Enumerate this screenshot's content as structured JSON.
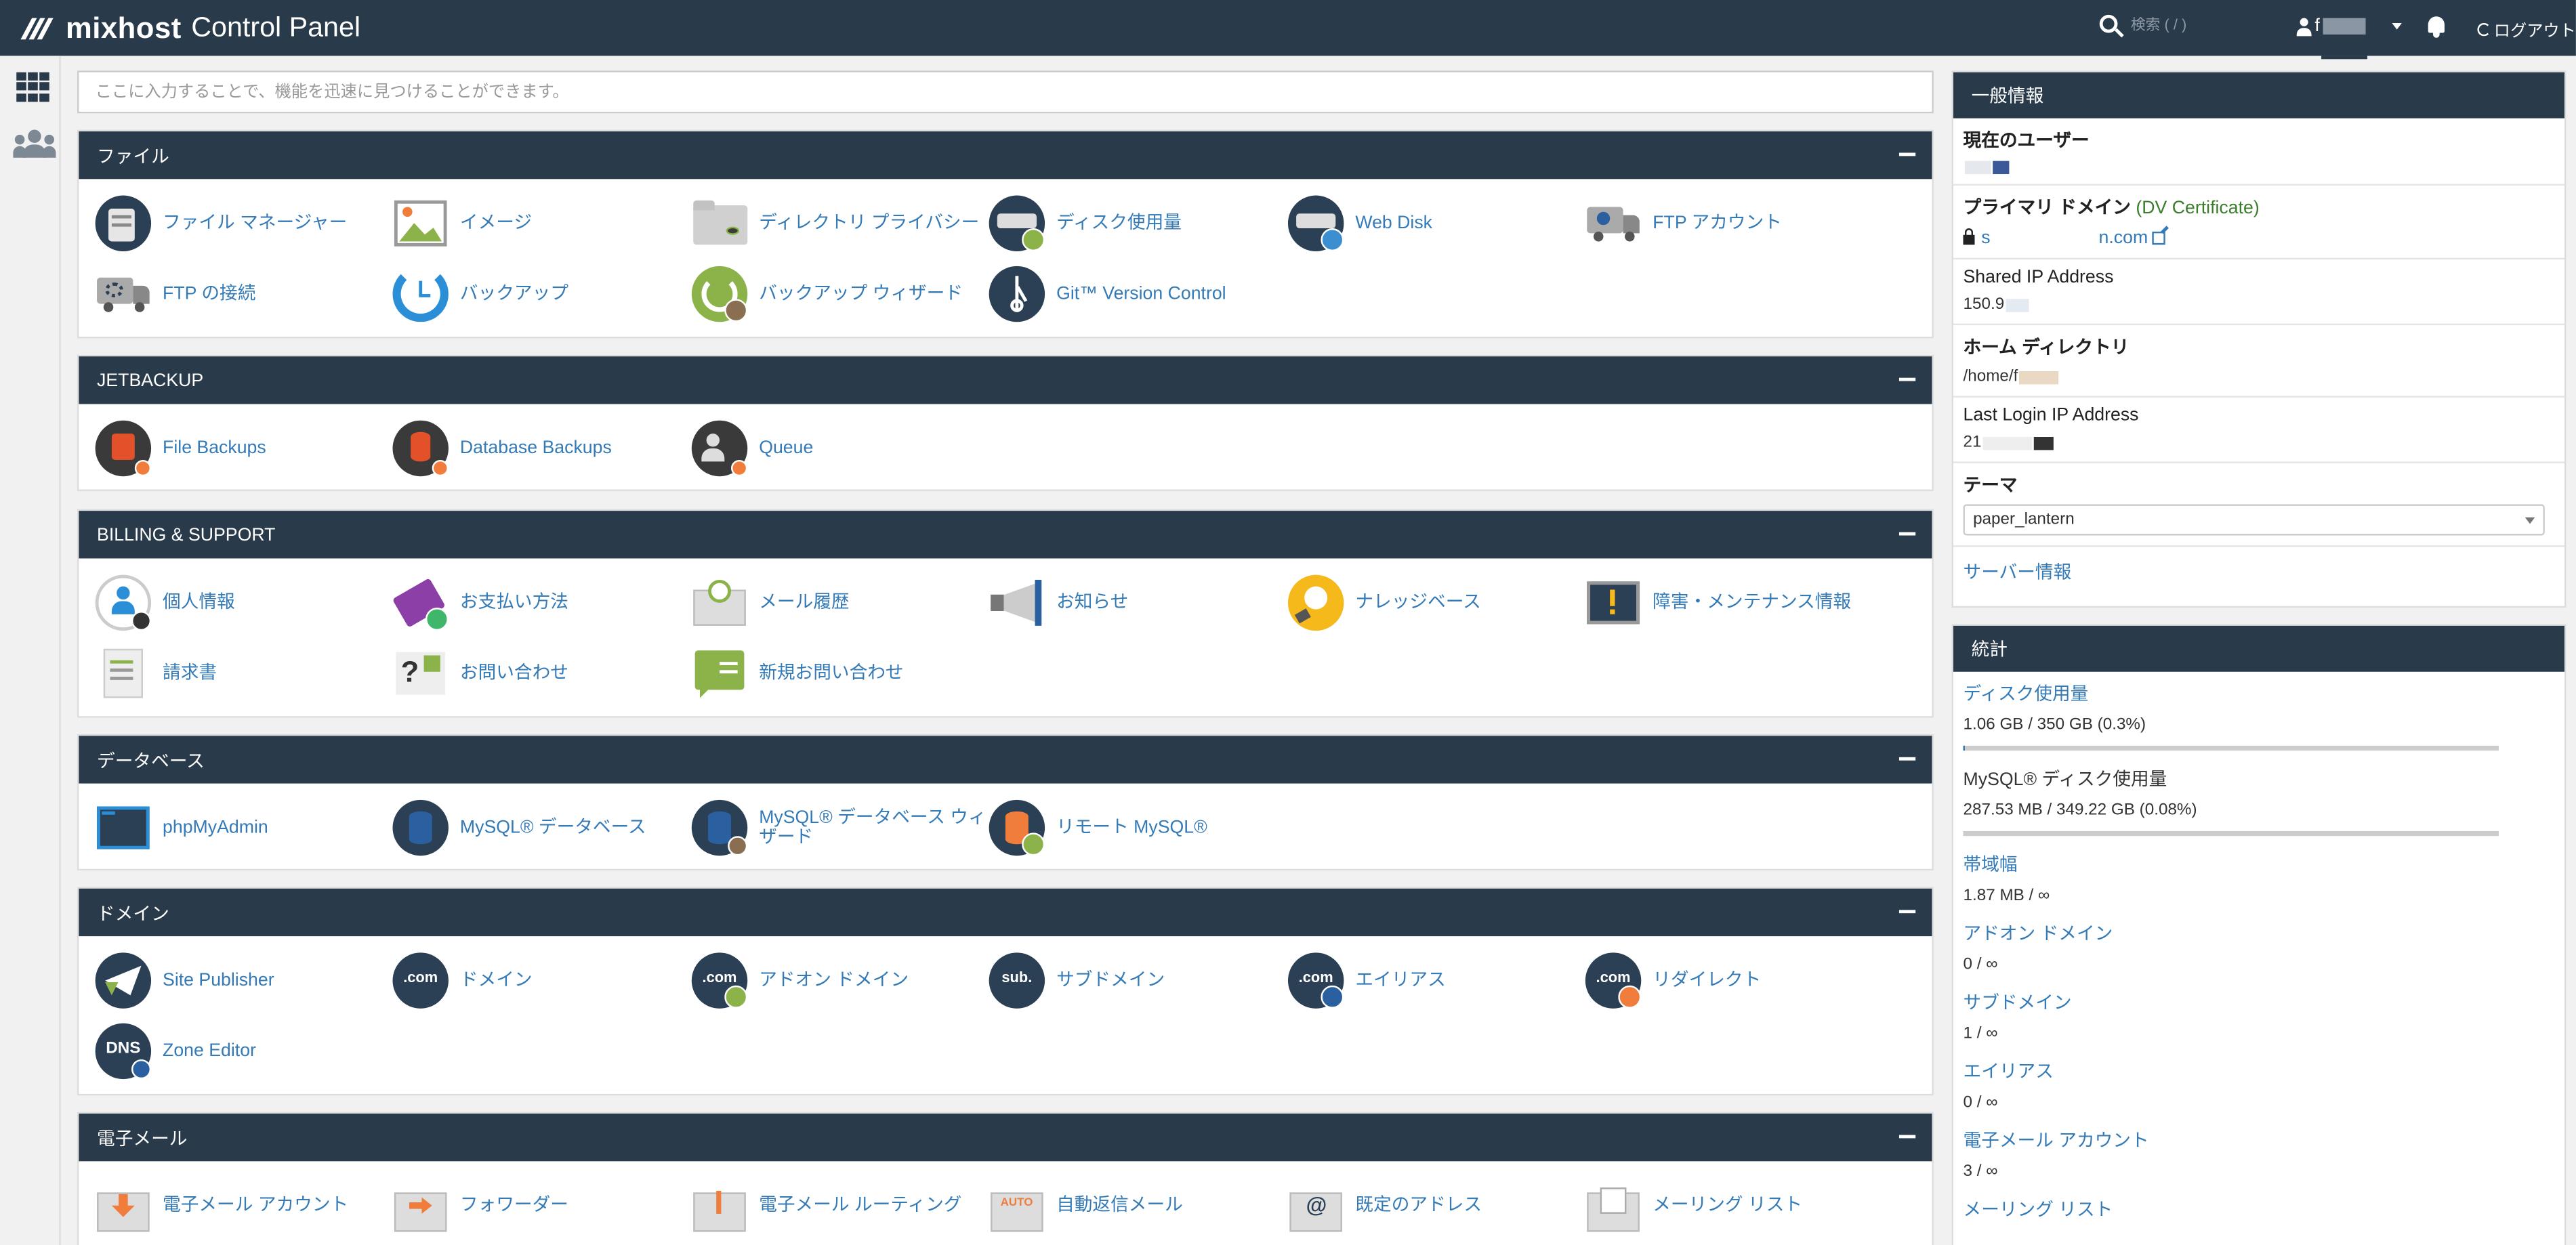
{
  "topbar": {
    "brand": "mixhost",
    "brand_sub": "Control Panel",
    "search_placeholder": "検索 ( / )",
    "user_initial": "f",
    "logout_label": "ログアウト"
  },
  "quick_search_placeholder": "ここに入力することで、機能を迅速に見つけることができます。",
  "panels": {
    "files": {
      "title": "ファイル",
      "items": [
        "ファイル マネージャー",
        "イメージ",
        "ディレクトリ プライバシー",
        "ディスク使用量",
        "Web Disk",
        "FTP アカウント",
        "FTP の接続",
        "バックアップ",
        "バックアップ ウィザード",
        "Git™ Version Control"
      ]
    },
    "jetbackup": {
      "title": "JETBACKUP",
      "items": [
        "File Backups",
        "Database Backups",
        "Queue"
      ]
    },
    "billing": {
      "title": "BILLING & SUPPORT",
      "items": [
        "個人情報",
        "お支払い方法",
        "メール履歴",
        "お知らせ",
        "ナレッジベース",
        "障害・メンテナンス情報",
        "請求書",
        "お問い合わせ",
        "新規お問い合わせ"
      ]
    },
    "database": {
      "title": "データベース",
      "items": [
        "phpMyAdmin",
        "MySQL® データベース",
        "MySQL® データベース ウィザード",
        "リモート MySQL®"
      ]
    },
    "domains": {
      "title": "ドメイン",
      "items": [
        "Site Publisher",
        "ドメイン",
        "アドオン ドメイン",
        "サブドメイン",
        "エイリアス",
        "リダイレクト",
        "Zone Editor"
      ]
    },
    "email": {
      "title": "電子メール",
      "items": [
        "電子メール アカウント",
        "フォワーダー",
        "電子メール ルーティング",
        "自動返信メール",
        "既定のアドレス",
        "メーリング リスト"
      ]
    }
  },
  "general_info": {
    "title": "一般情報",
    "current_user_label": "現在のユーザー",
    "primary_domain_label": "プライマリ ドメイン",
    "primary_domain_cert": "(DV Certificate)",
    "primary_domain_prefix": "s",
    "primary_domain_suffix": "n.com",
    "shared_ip_label": "Shared IP Address",
    "shared_ip_value": "150.9",
    "home_dir_label": "ホーム ディレクトリ",
    "home_dir_value": "/home/f",
    "last_login_label": "Last Login IP Address",
    "last_login_value": "21",
    "theme_label": "テーマ",
    "theme_value": "paper_lantern",
    "server_info_link": "サーバー情報"
  },
  "stats": {
    "title": "統計",
    "items": [
      {
        "label": "ディスク使用量",
        "value": "1.06 GB / 350 GB   (0.3%)",
        "bar": 0.003,
        "link": true
      },
      {
        "label": "MySQL® ディスク使用量",
        "value": "287.53 MB / 349.22 GB   (0.08%)",
        "bar": 0.0008,
        "link": false
      },
      {
        "label": "帯域幅",
        "value": "1.87 MB / ∞",
        "link": true
      },
      {
        "label": "アドオン ドメイン",
        "value": "0 / ∞",
        "link": true
      },
      {
        "label": "サブドメイン",
        "value": "1 / ∞",
        "link": true
      },
      {
        "label": "エイリアス",
        "value": "0 / ∞",
        "link": true
      },
      {
        "label": "電子メール アカウント",
        "value": "3 / ∞",
        "link": true
      },
      {
        "label": "メーリング リスト",
        "value": "",
        "link": true
      }
    ]
  }
}
